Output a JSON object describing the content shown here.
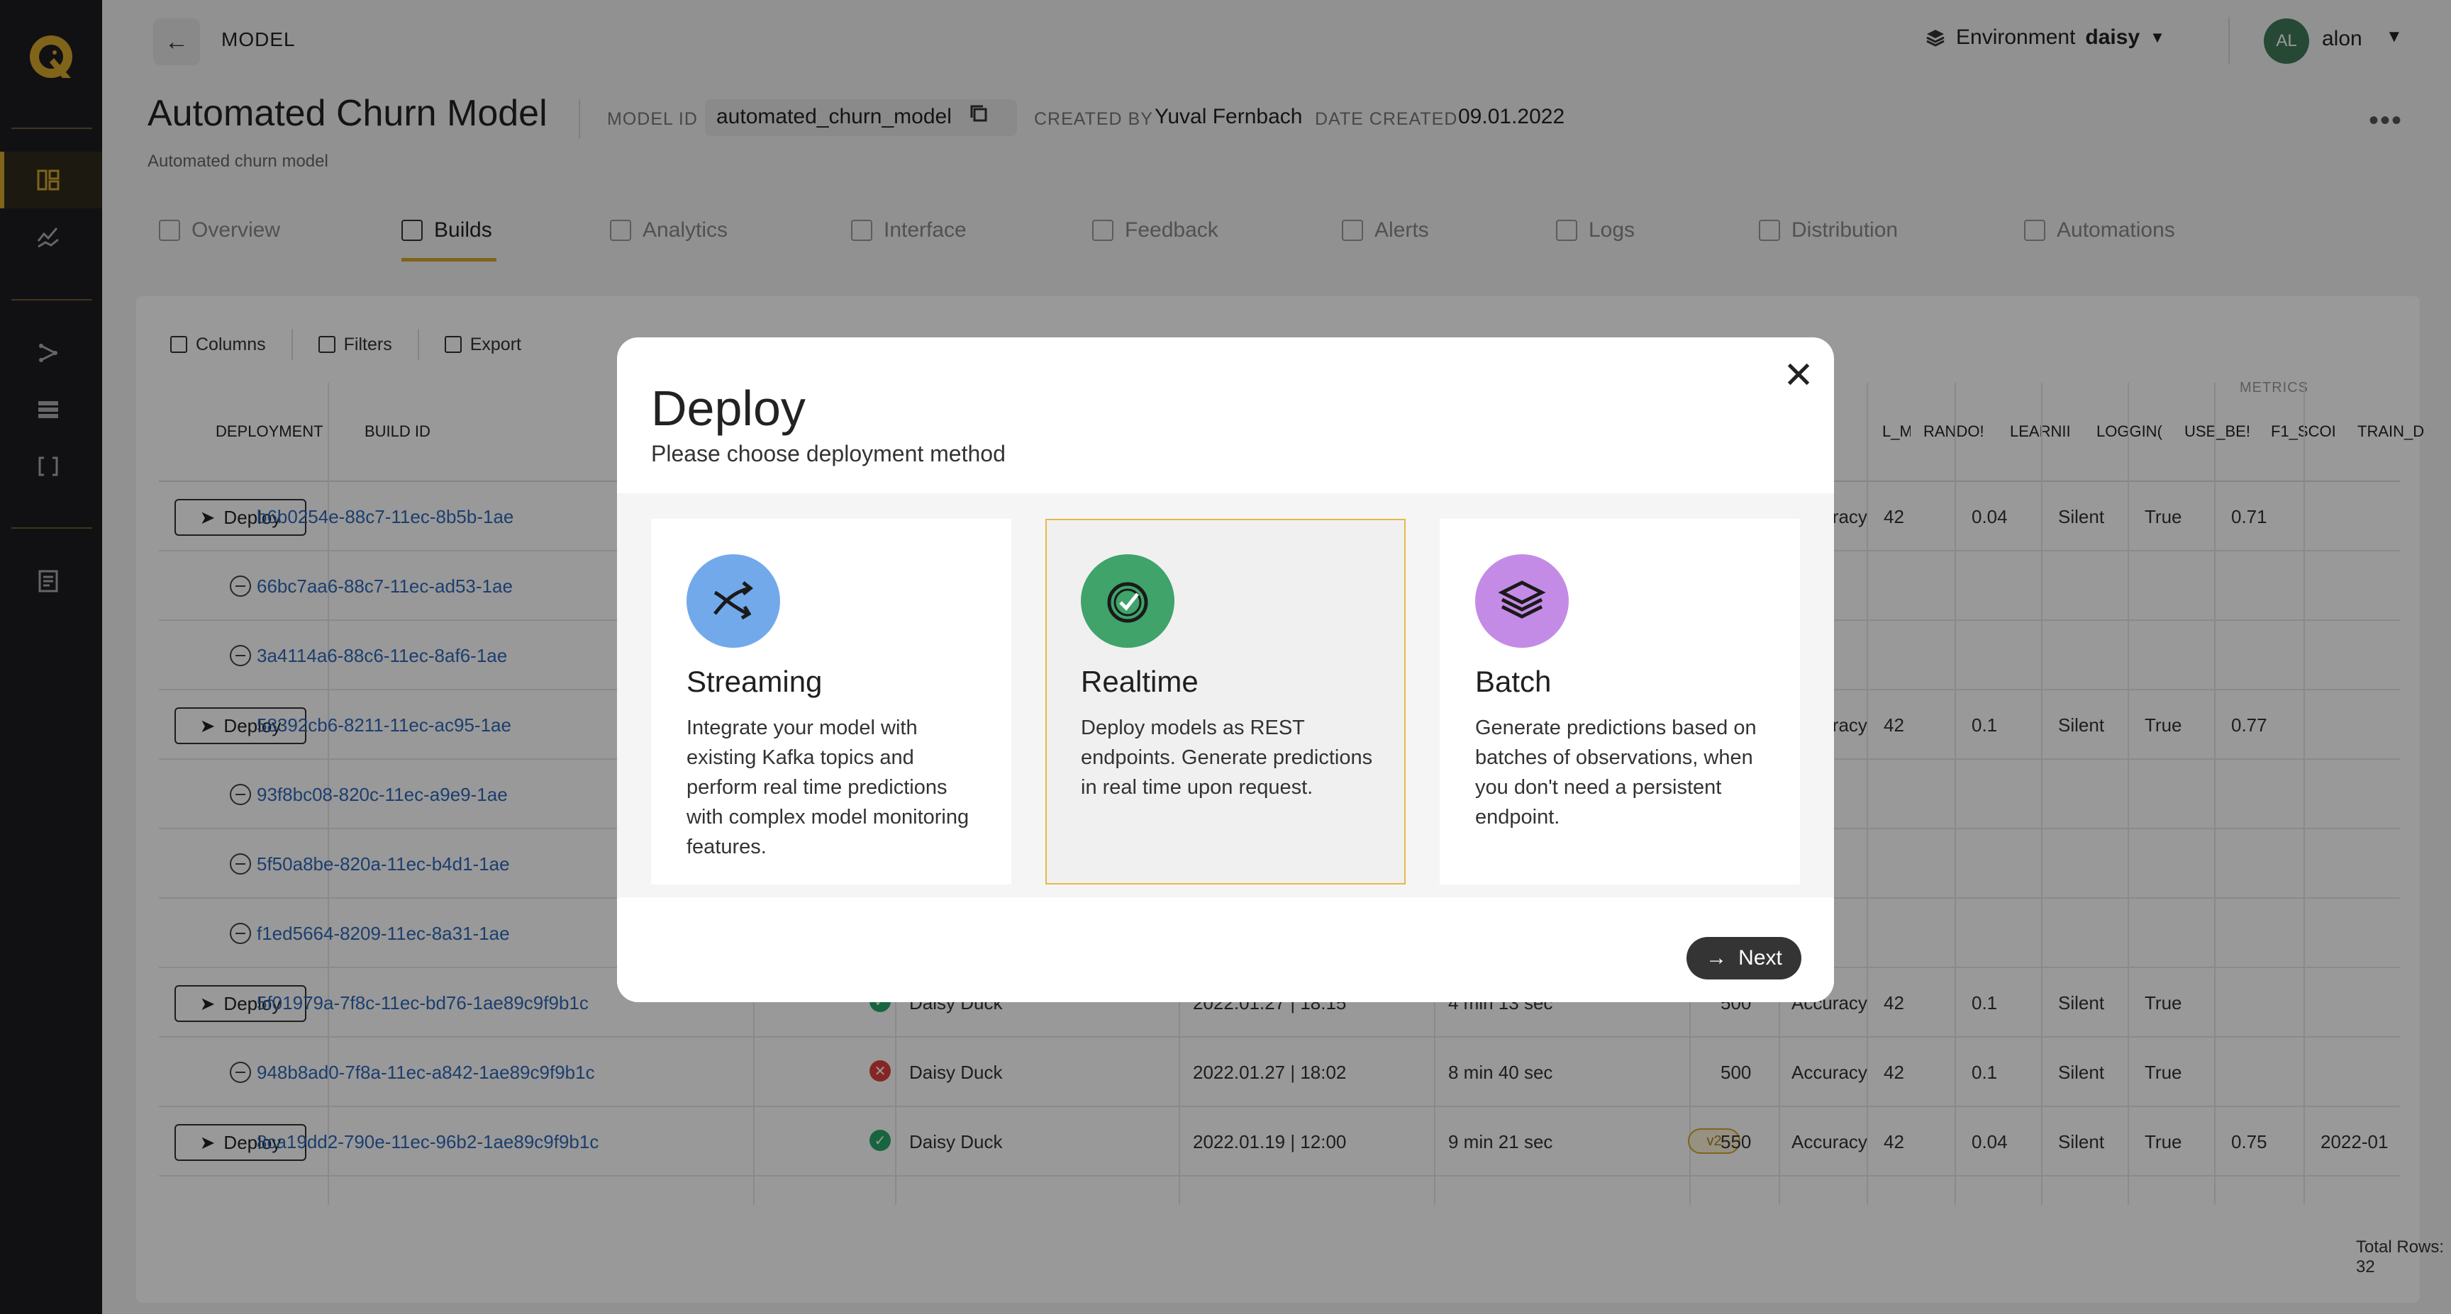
{
  "header": {
    "breadcrumb": "MODEL",
    "environment_label": "Environment",
    "environment_value": "daisy",
    "user_initials": "AL",
    "user_name": "alon"
  },
  "model": {
    "title": "Automated Churn Model",
    "description": "Automated churn model",
    "model_id_label": "MODEL ID",
    "model_id": "automated_churn_model",
    "created_by_label": "CREATED BY",
    "created_by": "Yuval Fernbach",
    "date_created_label": "DATE CREATED",
    "date_created": "09.01.2022"
  },
  "tabs": [
    {
      "label": "Overview",
      "icon": "overview-icon"
    },
    {
      "label": "Builds",
      "icon": "builds-icon",
      "active": true
    },
    {
      "label": "Analytics",
      "icon": "analytics-icon"
    },
    {
      "label": "Interface",
      "icon": "interface-icon"
    },
    {
      "label": "Feedback",
      "icon": "feedback-icon"
    },
    {
      "label": "Alerts",
      "icon": "bell-icon"
    },
    {
      "label": "Logs",
      "icon": "logs-icon"
    },
    {
      "label": "Distribution",
      "icon": "distribution-icon"
    },
    {
      "label": "Automations",
      "icon": "automations-icon"
    }
  ],
  "toolbar": {
    "columns": "Columns",
    "filters": "Filters",
    "export": "Export"
  },
  "table": {
    "metrics_group_label": "METRICS",
    "headers": {
      "deployment": "DEPLOYMENT",
      "build_id": "BUILD ID",
      "l_m": "L_M",
      "random": "RANDO!",
      "learning": "LEARNII",
      "logging": "LOGGIN(",
      "use_best": "USE_BE!",
      "f1_score": "F1_SCOI",
      "train": "TRAIN_D"
    },
    "deploy_label": "Deploy",
    "rows": [
      {
        "deploy": true,
        "build_id": "b6b0254e-88c7-11ec-8b5b-1ae",
        "status": "",
        "user": "",
        "date": "",
        "duration": "",
        "tag": "",
        "n": "",
        "metric": "Accuracy",
        "random": "42",
        "lr": "0.04",
        "logging": "Silent",
        "best": "True",
        "f1": "0.71",
        "train": ""
      },
      {
        "deploy": false,
        "build_id": "66bc7aa6-88c7-11ec-ad53-1ae",
        "status": "",
        "user": "",
        "date": "",
        "duration": "",
        "tag": "",
        "n": "",
        "metric": "",
        "random": "",
        "lr": "",
        "logging": "",
        "best": "",
        "f1": "",
        "train": ""
      },
      {
        "deploy": false,
        "build_id": "3a4114a6-88c6-11ec-8af6-1ae",
        "status": "",
        "user": "",
        "date": "",
        "duration": "",
        "tag": "",
        "n": "",
        "metric": "",
        "random": "",
        "lr": "",
        "logging": "",
        "best": "",
        "f1": "",
        "train": ""
      },
      {
        "deploy": true,
        "build_id": "58392cb6-8211-11ec-ac95-1ae",
        "status": "",
        "user": "",
        "date": "",
        "duration": "",
        "tag": "",
        "n": "",
        "metric": "Accuracy",
        "random": "42",
        "lr": "0.1",
        "logging": "Silent",
        "best": "True",
        "f1": "0.77",
        "train": ""
      },
      {
        "deploy": false,
        "build_id": "93f8bc08-820c-11ec-a9e9-1ae",
        "status": "",
        "user": "",
        "date": "",
        "duration": "",
        "tag": "",
        "n": "",
        "metric": "",
        "random": "",
        "lr": "",
        "logging": "",
        "best": "",
        "f1": "",
        "train": ""
      },
      {
        "deploy": false,
        "build_id": "5f50a8be-820a-11ec-b4d1-1ae",
        "status": "",
        "user": "",
        "date": "",
        "duration": "",
        "tag": "",
        "n": "",
        "metric": "",
        "random": "",
        "lr": "",
        "logging": "",
        "best": "",
        "f1": "",
        "train": ""
      },
      {
        "deploy": false,
        "build_id": "f1ed5664-8209-11ec-8a31-1ae",
        "status": "",
        "user": "",
        "date": "",
        "duration": "",
        "tag": "",
        "n": "",
        "metric": "",
        "random": "",
        "lr": "",
        "logging": "",
        "best": "",
        "f1": "",
        "train": ""
      },
      {
        "deploy": true,
        "build_id": "5f01979a-7f8c-11ec-bd76-1ae89c9f9b1c",
        "status": "ok",
        "user": "Daisy Duck",
        "date": "2022.01.27 | 18:15",
        "duration": "4 min 13 sec",
        "tag": "",
        "n": "500",
        "metric": "Accuracy",
        "random": "42",
        "lr": "0.1",
        "logging": "Silent",
        "best": "True",
        "f1": "",
        "train": ""
      },
      {
        "deploy": false,
        "build_id": "948b8ad0-7f8a-11ec-a842-1ae89c9f9b1c",
        "status": "fail",
        "user": "Daisy Duck",
        "date": "2022.01.27 | 18:02",
        "duration": "8 min 40 sec",
        "tag": "",
        "n": "500",
        "metric": "Accuracy",
        "random": "42",
        "lr": "0.1",
        "logging": "Silent",
        "best": "True",
        "f1": "",
        "train": ""
      },
      {
        "deploy": true,
        "build_id": "8ca19dd2-790e-11ec-96b2-1ae89c9f9b1c",
        "status": "ok",
        "user": "Daisy Duck",
        "date": "2022.01.19 | 12:00",
        "duration": "9 min 21 sec",
        "tag": "v2",
        "n": "550",
        "metric": "Accuracy",
        "random": "42",
        "lr": "0.04",
        "logging": "Silent",
        "best": "True",
        "f1": "0.75",
        "train": "2022-01"
      }
    ],
    "total_rows": "Total Rows: 32"
  },
  "modal": {
    "title": "Deploy",
    "subtitle": "Please choose deployment method",
    "options": [
      {
        "title": "Streaming",
        "description": "Integrate your model with existing Kafka topics and perform real time predictions with complex model monitoring features.",
        "icon": "streaming-arrows-icon",
        "color": "#72a9ea"
      },
      {
        "title": "Realtime",
        "description": "Deploy models as REST endpoints. Generate predictions in real time upon request.",
        "icon": "realtime-check-icon",
        "color": "#3fa36a",
        "selected": true
      },
      {
        "title": "Batch",
        "description": "Generate predictions based on batches of observations, when you don't need a persistent endpoint.",
        "icon": "batch-layers-icon",
        "color": "#c48be6"
      }
    ],
    "next_label": "Next"
  },
  "colors": {
    "accent": "#d4a72c",
    "sidebar": "#1d1d22",
    "link": "#2f68b8",
    "success": "#2aa76b",
    "error": "#e0403d"
  }
}
